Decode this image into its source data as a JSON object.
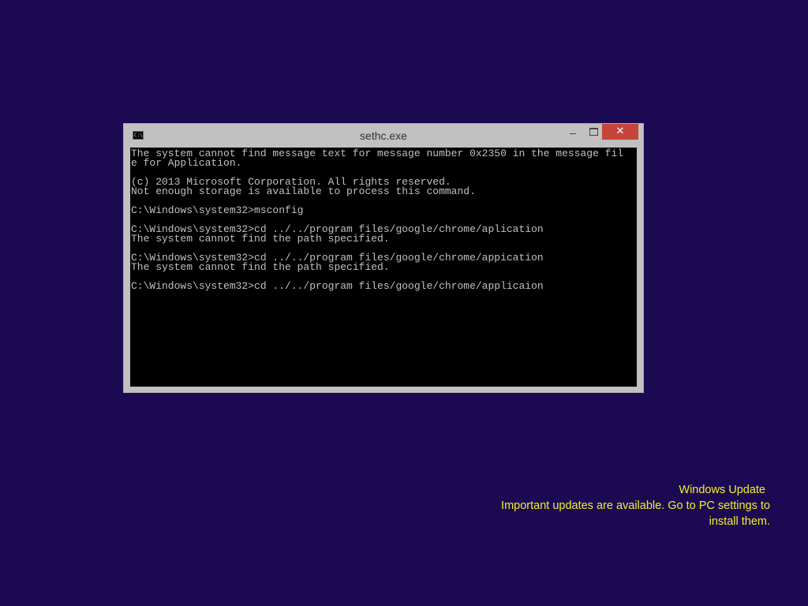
{
  "window": {
    "title": "sethc.exe",
    "icon": "command-prompt-icon",
    "icon_text": "C:\\",
    "close_glyph": "✕"
  },
  "console": {
    "lines": [
      "The system cannot find message text for message number 0x2350 in the message fil",
      "e for Application.",
      "",
      "(c) 2013 Microsoft Corporation. All rights reserved.",
      "Not enough storage is available to process this command.",
      "",
      "C:\\Windows\\system32>msconfig",
      "",
      "C:\\Windows\\system32>cd ../../program files/google/chrome/aplication",
      "The system cannot find the path specified.",
      "",
      "C:\\Windows\\system32>cd ../../program files/google/chrome/appication",
      "The system cannot find the path specified.",
      "",
      "C:\\Windows\\system32>cd ../../program files/google/chrome/applicaion"
    ]
  },
  "notification": {
    "title": "Windows Update",
    "message_line1": "Important updates are available. Go to PC settings to",
    "message_line2": "install them."
  },
  "colors": {
    "desktop_background": "#1b0a52",
    "window_frame": "#c1c1c1",
    "close_button": "#c7443b",
    "console_background": "#000000",
    "console_text": "#c0c0c0",
    "notification_text": "#f2ee2e"
  }
}
